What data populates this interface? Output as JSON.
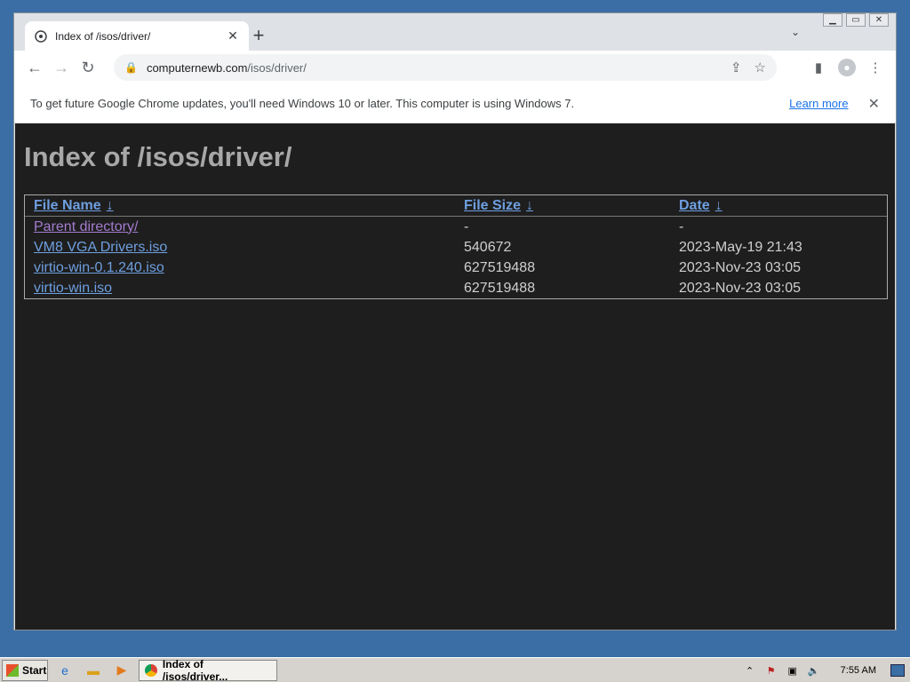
{
  "browser": {
    "tab_title": "Index of /isos/driver/",
    "url_host": "computernewb.com",
    "url_path": "/isos/driver/",
    "window_controls": [
      "minimize",
      "maximize",
      "close"
    ]
  },
  "infobar": {
    "message": "To get future Google Chrome updates, you'll need Windows 10 or later. This computer is using Windows 7.",
    "learn_more": "Learn more"
  },
  "page": {
    "title": "Index of /isos/driver/",
    "columns": [
      {
        "label": "File Name",
        "arrow": "↓"
      },
      {
        "label": "File Size",
        "arrow": "↓"
      },
      {
        "label": "Date",
        "arrow": "↓"
      }
    ],
    "rows": [
      {
        "name": "Parent directory/",
        "size": "-",
        "date": "-"
      },
      {
        "name": "VM8 VGA Drivers.iso",
        "size": "540672",
        "date": "2023-May-19 21:43"
      },
      {
        "name": "virtio-win-0.1.240.iso",
        "size": "627519488",
        "date": "2023-Nov-23 03:05"
      },
      {
        "name": "virtio-win.iso",
        "size": "627519488",
        "date": "2023-Nov-23 03:05"
      }
    ]
  },
  "taskbar": {
    "start_label": "Start",
    "task_label": "Index of /isos/driver...",
    "clock": "7:55 AM"
  },
  "colors": {
    "page_background": "#1e1e1e",
    "link": "#6e9fe0",
    "visited_link": "#a47ccf",
    "desktop": "#3a6ea5"
  }
}
